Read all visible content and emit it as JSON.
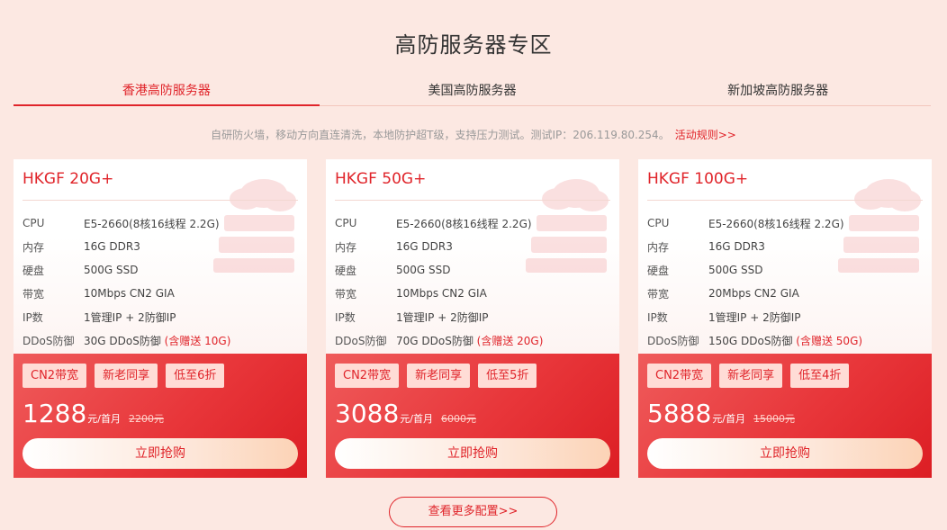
{
  "page": {
    "title": "高防服务器专区"
  },
  "tabs": [
    {
      "label": "香港高防服务器",
      "active": true
    },
    {
      "label": "美国高防服务器",
      "active": false
    },
    {
      "label": "新加坡高防服务器",
      "active": false
    }
  ],
  "notice": {
    "text": "自研防火墙，移动方向直连清洗，本地防护超T级，支持压力测试。测试IP：206.119.80.254。",
    "link": "活动规则>>"
  },
  "spec_labels": [
    "CPU",
    "内存",
    "硬盘",
    "带宽",
    "IP数",
    "DDoS防御"
  ],
  "cards": [
    {
      "name": "HKGF 20G+",
      "cpu": "E5-2660(8核16线程 2.2G)",
      "ram": "16G DDR3",
      "disk": "500G SSD",
      "bandwidth": "10Mbps CN2 GIA",
      "ip": "1管理IP + 2防御IP",
      "ddos": "30G DDoS防御",
      "ddos_gift": "(含赠送 10G)",
      "tags": [
        "CN2带宽",
        "新老同享",
        "低至6折"
      ],
      "price": "1288",
      "price_unit": "元/首月",
      "old_price": "2200元",
      "buy_label": "立即抢购"
    },
    {
      "name": "HKGF 50G+",
      "cpu": "E5-2660(8核16线程 2.2G)",
      "ram": "16G DDR3",
      "disk": "500G SSD",
      "bandwidth": "10Mbps CN2 GIA",
      "ip": "1管理IP + 2防御IP",
      "ddos": "70G DDoS防御",
      "ddos_gift": "(含赠送 20G)",
      "tags": [
        "CN2带宽",
        "新老同享",
        "低至5折"
      ],
      "price": "3088",
      "price_unit": "元/首月",
      "old_price": "6000元",
      "buy_label": "立即抢购"
    },
    {
      "name": "HKGF 100G+",
      "cpu": "E5-2660(8核16线程 2.2G)",
      "ram": "16G DDR3",
      "disk": "500G SSD",
      "bandwidth": "20Mbps CN2 GIA",
      "ip": "1管理IP + 2防御IP",
      "ddos": "150G DDoS防御",
      "ddos_gift": "(含赠送 50G)",
      "tags": [
        "CN2带宽",
        "新老同享",
        "低至4折"
      ],
      "price": "5888",
      "price_unit": "元/首月",
      "old_price": "15000元",
      "buy_label": "立即抢购"
    }
  ],
  "more_button": "查看更多配置>>",
  "colors": {
    "accent": "#e0242a",
    "background": "#fce8e2",
    "tag_bg": "#ffdcd6"
  },
  "icons": {
    "card_decoration": "cloud-server-icon"
  }
}
